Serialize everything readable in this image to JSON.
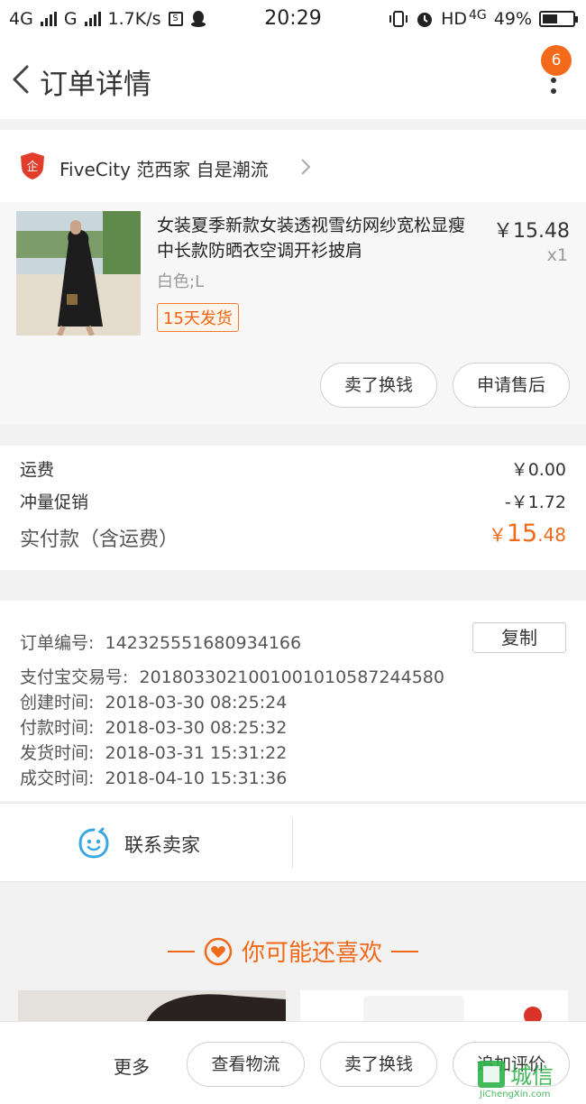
{
  "status_bar": {
    "net1": "4G",
    "net2": "G",
    "speed": "1.7K/s",
    "time": "20:29",
    "hd": "HD",
    "net3": "4G",
    "battery": "49%",
    "battery_level": 0.49
  },
  "header": {
    "title": "订单详情",
    "badge_count": "6"
  },
  "shop": {
    "name": "FiveCity 范西家 自是潮流"
  },
  "product": {
    "title": "女装夏季新款女装透视雪纺网纱宽松显瘦中长款防晒衣空调开衫披肩",
    "price": "￥15.48",
    "quantity": "x1",
    "sku": "白色;L",
    "shipping_tag": "15天发货",
    "actions": [
      "卖了换钱",
      "申请售后"
    ]
  },
  "fees": {
    "shipping_label": "运费",
    "shipping_value": "￥0.00",
    "promo_label": "冲量促销",
    "promo_value": "-￥1.72",
    "total_label": "实付款（含运费）",
    "total_currency": "￥",
    "total_int": "15",
    "total_dec": ".48"
  },
  "order_info": {
    "order_no_label": "订单编号:",
    "order_no": "142325551680934166",
    "copy_label": "复制",
    "alipay_label": "支付宝交易号:",
    "alipay_no": "2018033021001001010587244580",
    "created_label": "创建时间:",
    "created": "2018-03-30 08:25:24",
    "paid_label": "付款时间:",
    "paid": "2018-03-30 08:25:32",
    "shipped_label": "发货时间:",
    "shipped": "2018-03-31 15:31:22",
    "closed_label": "成交时间:",
    "closed": "2018-04-10 15:31:36"
  },
  "contact": {
    "label": "联系卖家"
  },
  "recommend": {
    "title": "你可能还喜欢"
  },
  "bottom_bar": {
    "more": "更多",
    "actions": [
      "查看物流",
      "卖了换钱",
      "追加评价"
    ]
  },
  "watermark": {
    "text": "城信",
    "url_text": "JiChengXin.com"
  },
  "colors": {
    "accent": "#f06a1a",
    "badge": "#f56a1a",
    "contact_icon": "#3aa8e0"
  }
}
